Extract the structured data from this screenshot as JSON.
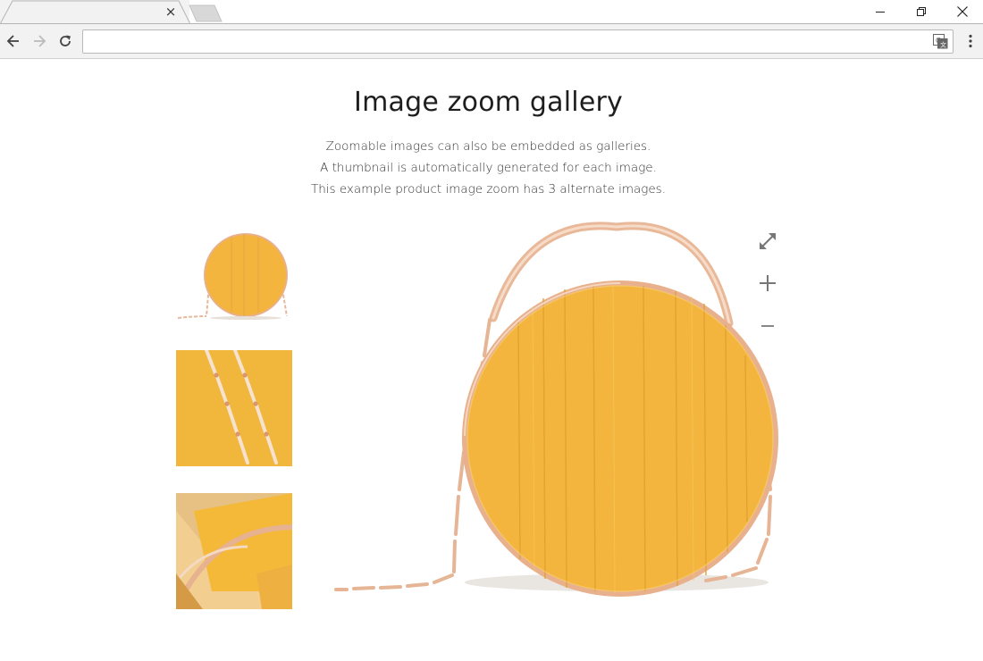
{
  "browser": {
    "tab": {
      "title": "",
      "close_glyph": "×"
    },
    "address": {
      "value": "",
      "placeholder": ""
    },
    "icons": {
      "back": "back-arrow-icon",
      "forward": "forward-arrow-icon",
      "reload": "reload-icon",
      "translate": "translate-icon",
      "menu": "kebab-menu-icon",
      "minimize": "minimize-icon",
      "restore": "restore-icon",
      "close": "close-icon"
    }
  },
  "page": {
    "title": "Image zoom gallery",
    "intro": [
      "Zoomable images can also be embedded as galleries.",
      "A thumbnail is automatically generated for each image.",
      "This example product image zoom has 3 alternate images."
    ]
  },
  "gallery": {
    "thumbnails": [
      {
        "name": "thumbnail-bag-front"
      },
      {
        "name": "thumbnail-chain-detail"
      },
      {
        "name": "thumbnail-bag-interior"
      }
    ],
    "controls": {
      "fullscreen": "expand-arrows-icon",
      "zoom_in": "plus-icon",
      "zoom_out": "minus-icon"
    }
  },
  "colors": {
    "bag_yellow": "#f3b53d",
    "bag_yellow_dark": "#e0a02a",
    "gold_metal": "#e8b08c",
    "control_gray": "#777777"
  }
}
